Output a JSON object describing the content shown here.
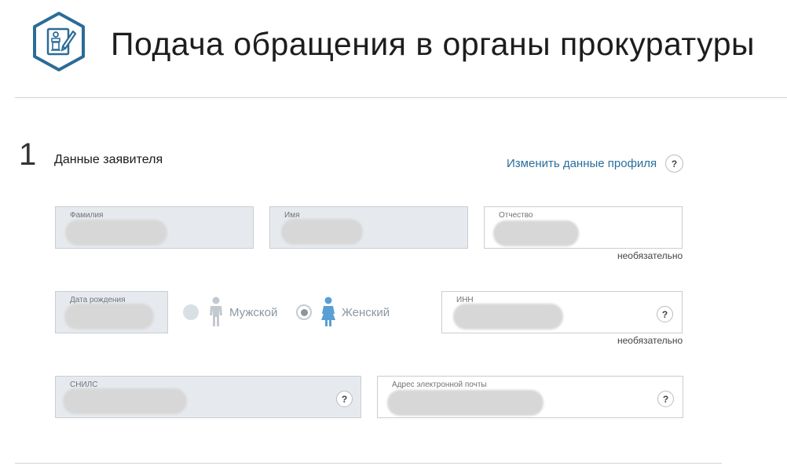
{
  "header": {
    "title": "Подача обращения в органы прокуратуры"
  },
  "section": {
    "number": "1",
    "title": "Данные заявителя",
    "edit_link": "Изменить данные профиля"
  },
  "fields": {
    "surname": {
      "label": "Фамилия"
    },
    "name": {
      "label": "Имя"
    },
    "patronymic": {
      "label": "Отчество",
      "note": "необязательно"
    },
    "birthdate": {
      "label": "Дата рождения"
    },
    "inn": {
      "label": "ИНН",
      "note": "необязательно"
    },
    "snils": {
      "label": "СНИЛС"
    },
    "email": {
      "label": "Адрес электронной почты"
    }
  },
  "gender": {
    "male": {
      "label": "Мужской",
      "selected": false
    },
    "female": {
      "label": "Женский",
      "selected": true
    }
  },
  "help_glyph": "?",
  "colors": {
    "brand": "#2b6c97",
    "link": "#2a6e9c",
    "disabled_field": "#e6eaee",
    "female_icon": "#5a9fd4",
    "male_icon": "#c3c9ce"
  }
}
